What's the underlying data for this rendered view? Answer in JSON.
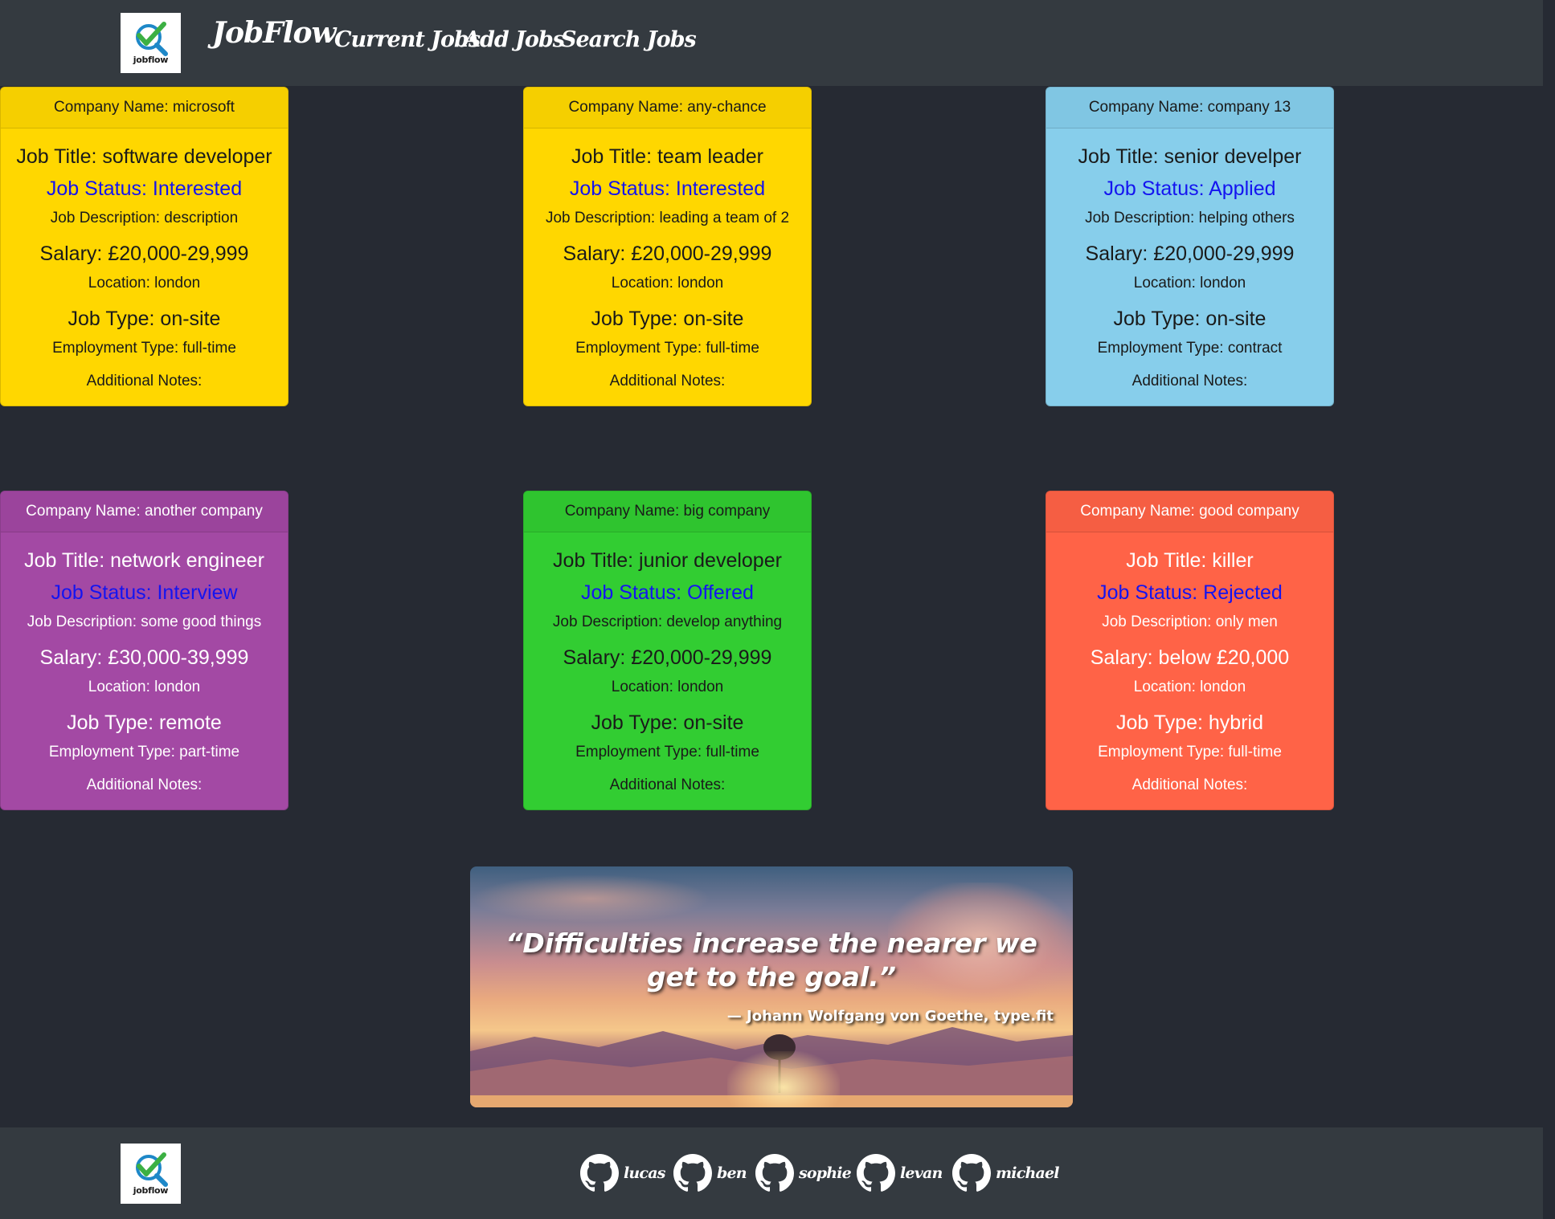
{
  "header": {
    "logo_text": "jobflow",
    "brand": "JobFlow",
    "nav": [
      "Current Jobs",
      "Add Jobs",
      "Search Jobs"
    ]
  },
  "jobs": [
    {
      "company": "Company Name: microsoft",
      "title": "Job Title: software developer",
      "status": "Job Status: Interested",
      "description": "Job Description: description",
      "salary": "Salary: £20,000-29,999",
      "location": "Location: london",
      "job_type": "Job Type: on-site",
      "employment": "Employment Type: full-time",
      "notes": "Additional Notes:",
      "color": "#ffd700",
      "header_color": "#f5cf00"
    },
    {
      "company": "Company Name: any-chance",
      "title": "Job Title: team leader",
      "status": "Job Status: Interested",
      "description": "Job Description: leading a team of 2",
      "salary": "Salary: £20,000-29,999",
      "location": "Location: london",
      "job_type": "Job Type: on-site",
      "employment": "Employment Type: full-time",
      "notes": "Additional Notes:",
      "color": "#ffd700",
      "header_color": "#f5cf00"
    },
    {
      "company": "Company Name: company 13",
      "title": "Job Title: senior develper",
      "status": "Job Status: Applied",
      "description": "Job Description: helping others",
      "salary": "Salary: £20,000-29,999",
      "location": "Location: london",
      "job_type": "Job Type: on-site",
      "employment": "Employment Type: contract",
      "notes": "Additional Notes:",
      "color": "#87ceeb",
      "header_color": "#80c6e3"
    },
    {
      "company": "Company Name: another company",
      "title": "Job Title: network engineer",
      "status": "Job Status: Interview",
      "description": "Job Description: some good things",
      "salary": "Salary: £30,000-39,999",
      "location": "Location: london",
      "job_type": "Job Type: remote",
      "employment": "Employment Type: part-time",
      "notes": "Additional Notes:",
      "color": "#a349a4",
      "header_color": "#9b449c"
    },
    {
      "company": "Company Name: big company",
      "title": "Job Title: junior developer",
      "status": "Job Status: Offered",
      "description": "Job Description: develop anything",
      "salary": "Salary: £20,000-29,999",
      "location": "Location: london",
      "job_type": "Job Type: on-site",
      "employment": "Employment Type: full-time",
      "notes": "Additional Notes:",
      "color": "#32cd32",
      "header_color": "#2fc42f"
    },
    {
      "company": "Company Name: good company",
      "title": "Job Title: killer",
      "status": "Job Status: Rejected",
      "description": "Job Description: only men",
      "salary": "Salary: below £20,000",
      "location": "Location: london",
      "job_type": "Job Type: hybrid",
      "employment": "Employment Type: full-time",
      "notes": "Additional Notes:",
      "color": "#ff6347",
      "header_color": "#f55e43"
    }
  ],
  "quote": {
    "text": "“Difficulties increase the nearer we get to the goal.”",
    "author": "— Johann Wolfgang von Goethe, type.fit"
  },
  "footer": {
    "logo_text": "jobflow",
    "contributors": [
      "lucas",
      "ben",
      "sophie",
      "levan",
      "michael"
    ]
  }
}
